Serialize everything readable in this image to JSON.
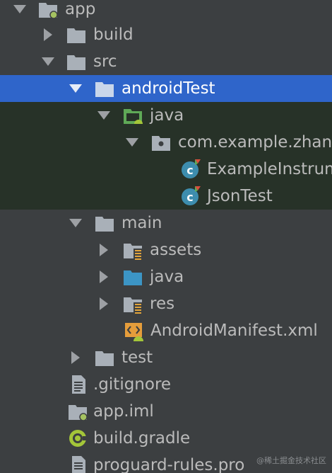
{
  "project_tree": {
    "app": "app",
    "build": "build",
    "src": "src",
    "android_test": "androidTest",
    "android_test_java": "java",
    "package": "com.example.zhangjiaxing",
    "example_instrumented_test": "ExampleInstrumentedTest",
    "json_test": "JsonTest",
    "main": "main",
    "assets": "assets",
    "main_java": "java",
    "res": "res",
    "android_manifest": "AndroidManifest.xml",
    "test": "test",
    "gitignore": ".gitignore",
    "app_iml": "app.iml",
    "build_gradle": "build.gradle",
    "proguard_rules": "proguard-rules.pro"
  },
  "watermark": "@稀土掘金技术社区",
  "icons": {
    "folder": "folder-icon",
    "module": "module-folder-icon",
    "test_source_root": "test-source-root-icon",
    "package": "package-icon",
    "kotlin_class": "class-icon",
    "resource_folder": "resource-folder-icon",
    "source_folder": "source-folder-icon",
    "manifest": "manifest-icon",
    "text_file": "text-file-icon",
    "iml_file": "iml-file-icon",
    "gradle": "gradle-icon"
  },
  "colors": {
    "background": "#3c3f41",
    "selected_row": "#2f65ca",
    "test_scope": "#273228",
    "folder": "#a9b0b8",
    "source_folder": "#3c95c5",
    "test_root": "#5fa957",
    "class_badge": "#3d8dae",
    "text": "#bbbbbb"
  }
}
